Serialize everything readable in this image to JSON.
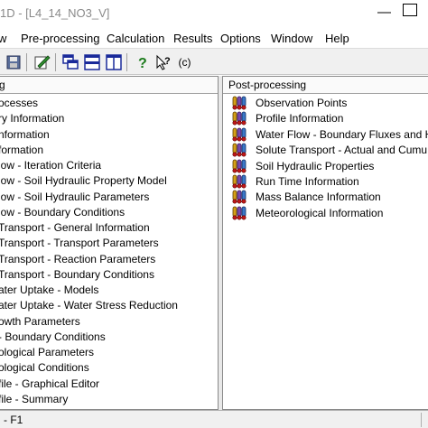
{
  "window": {
    "title": "1D - [L4_14_NO3_V]"
  },
  "menu": [
    "w",
    "Pre-processing",
    "Calculation",
    "Results",
    "Options",
    "Window",
    "Help"
  ],
  "toolbar": {
    "about_label": "(c)"
  },
  "left_pane": {
    "header": "g",
    "items": [
      "ocesses",
      "ry Information",
      "nformation",
      "formation",
      "low - Iteration Criteria",
      "low - Soil Hydraulic Property Model",
      "low - Soil Hydraulic Parameters",
      "low - Boundary Conditions",
      "Transport - General Information",
      "Transport - Transport Parameters",
      "Transport - Reaction Parameters",
      "Transport - Boundary Conditions",
      "ater Uptake - Models",
      "ater Uptake - Water Stress Reduction",
      "owth Parameters",
      "- Boundary Conditions",
      "ological Parameters",
      "ological Conditions",
      "file - Graphical Editor",
      "file - Summary"
    ]
  },
  "right_pane": {
    "header": "Post-processing",
    "items": [
      "Observation Points",
      "Profile Information",
      "Water Flow - Boundary Fluxes and H",
      "Solute Transport - Actual and Cumu",
      "Soil Hydraulic Properties",
      "Run Time Information",
      "Mass Balance Information",
      "Meteorological Information"
    ]
  },
  "statusbar": {
    "text": "- F1"
  }
}
